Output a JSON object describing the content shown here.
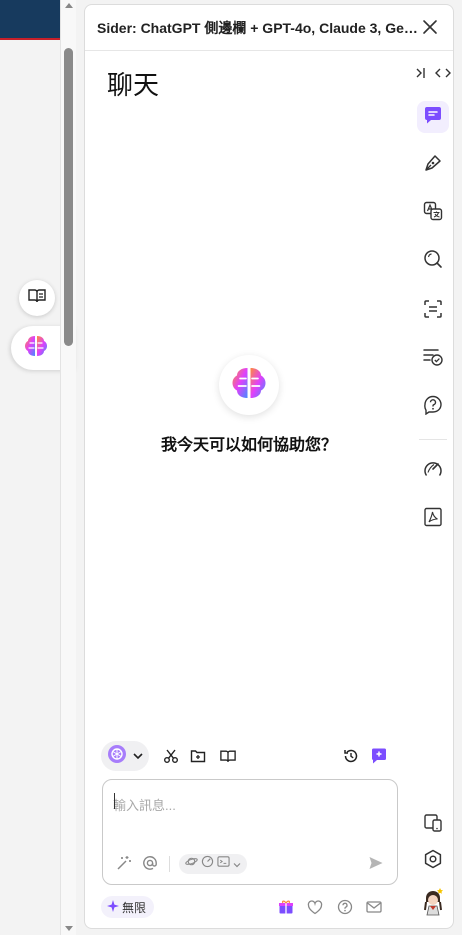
{
  "panel": {
    "title": "Sider: ChatGPT 側邊欄 + GPT-4o, Claude 3, Gemi..."
  },
  "chat": {
    "title": "聊天",
    "welcome": "我今天可以如何協助您？"
  },
  "input": {
    "placeholder": "輸入訊息..."
  },
  "footer": {
    "quota_label": "無限"
  },
  "colors": {
    "accent": "#7c4dff",
    "page_header": "#173a5e",
    "page_header_border": "#c8202a"
  },
  "icons": {
    "rail": [
      "chat-icon",
      "write-icon",
      "translate-icon",
      "search-icon",
      "ocr-scan-icon",
      "grammar-check-icon",
      "help-question-icon",
      "speedometer-icon",
      "pdf-icon",
      "devices-icon",
      "settings-icon"
    ],
    "toolbar": [
      "model-selector-icon",
      "scissors-icon",
      "add-folder-icon",
      "book-icon",
      "history-icon",
      "new-chat-icon"
    ]
  }
}
